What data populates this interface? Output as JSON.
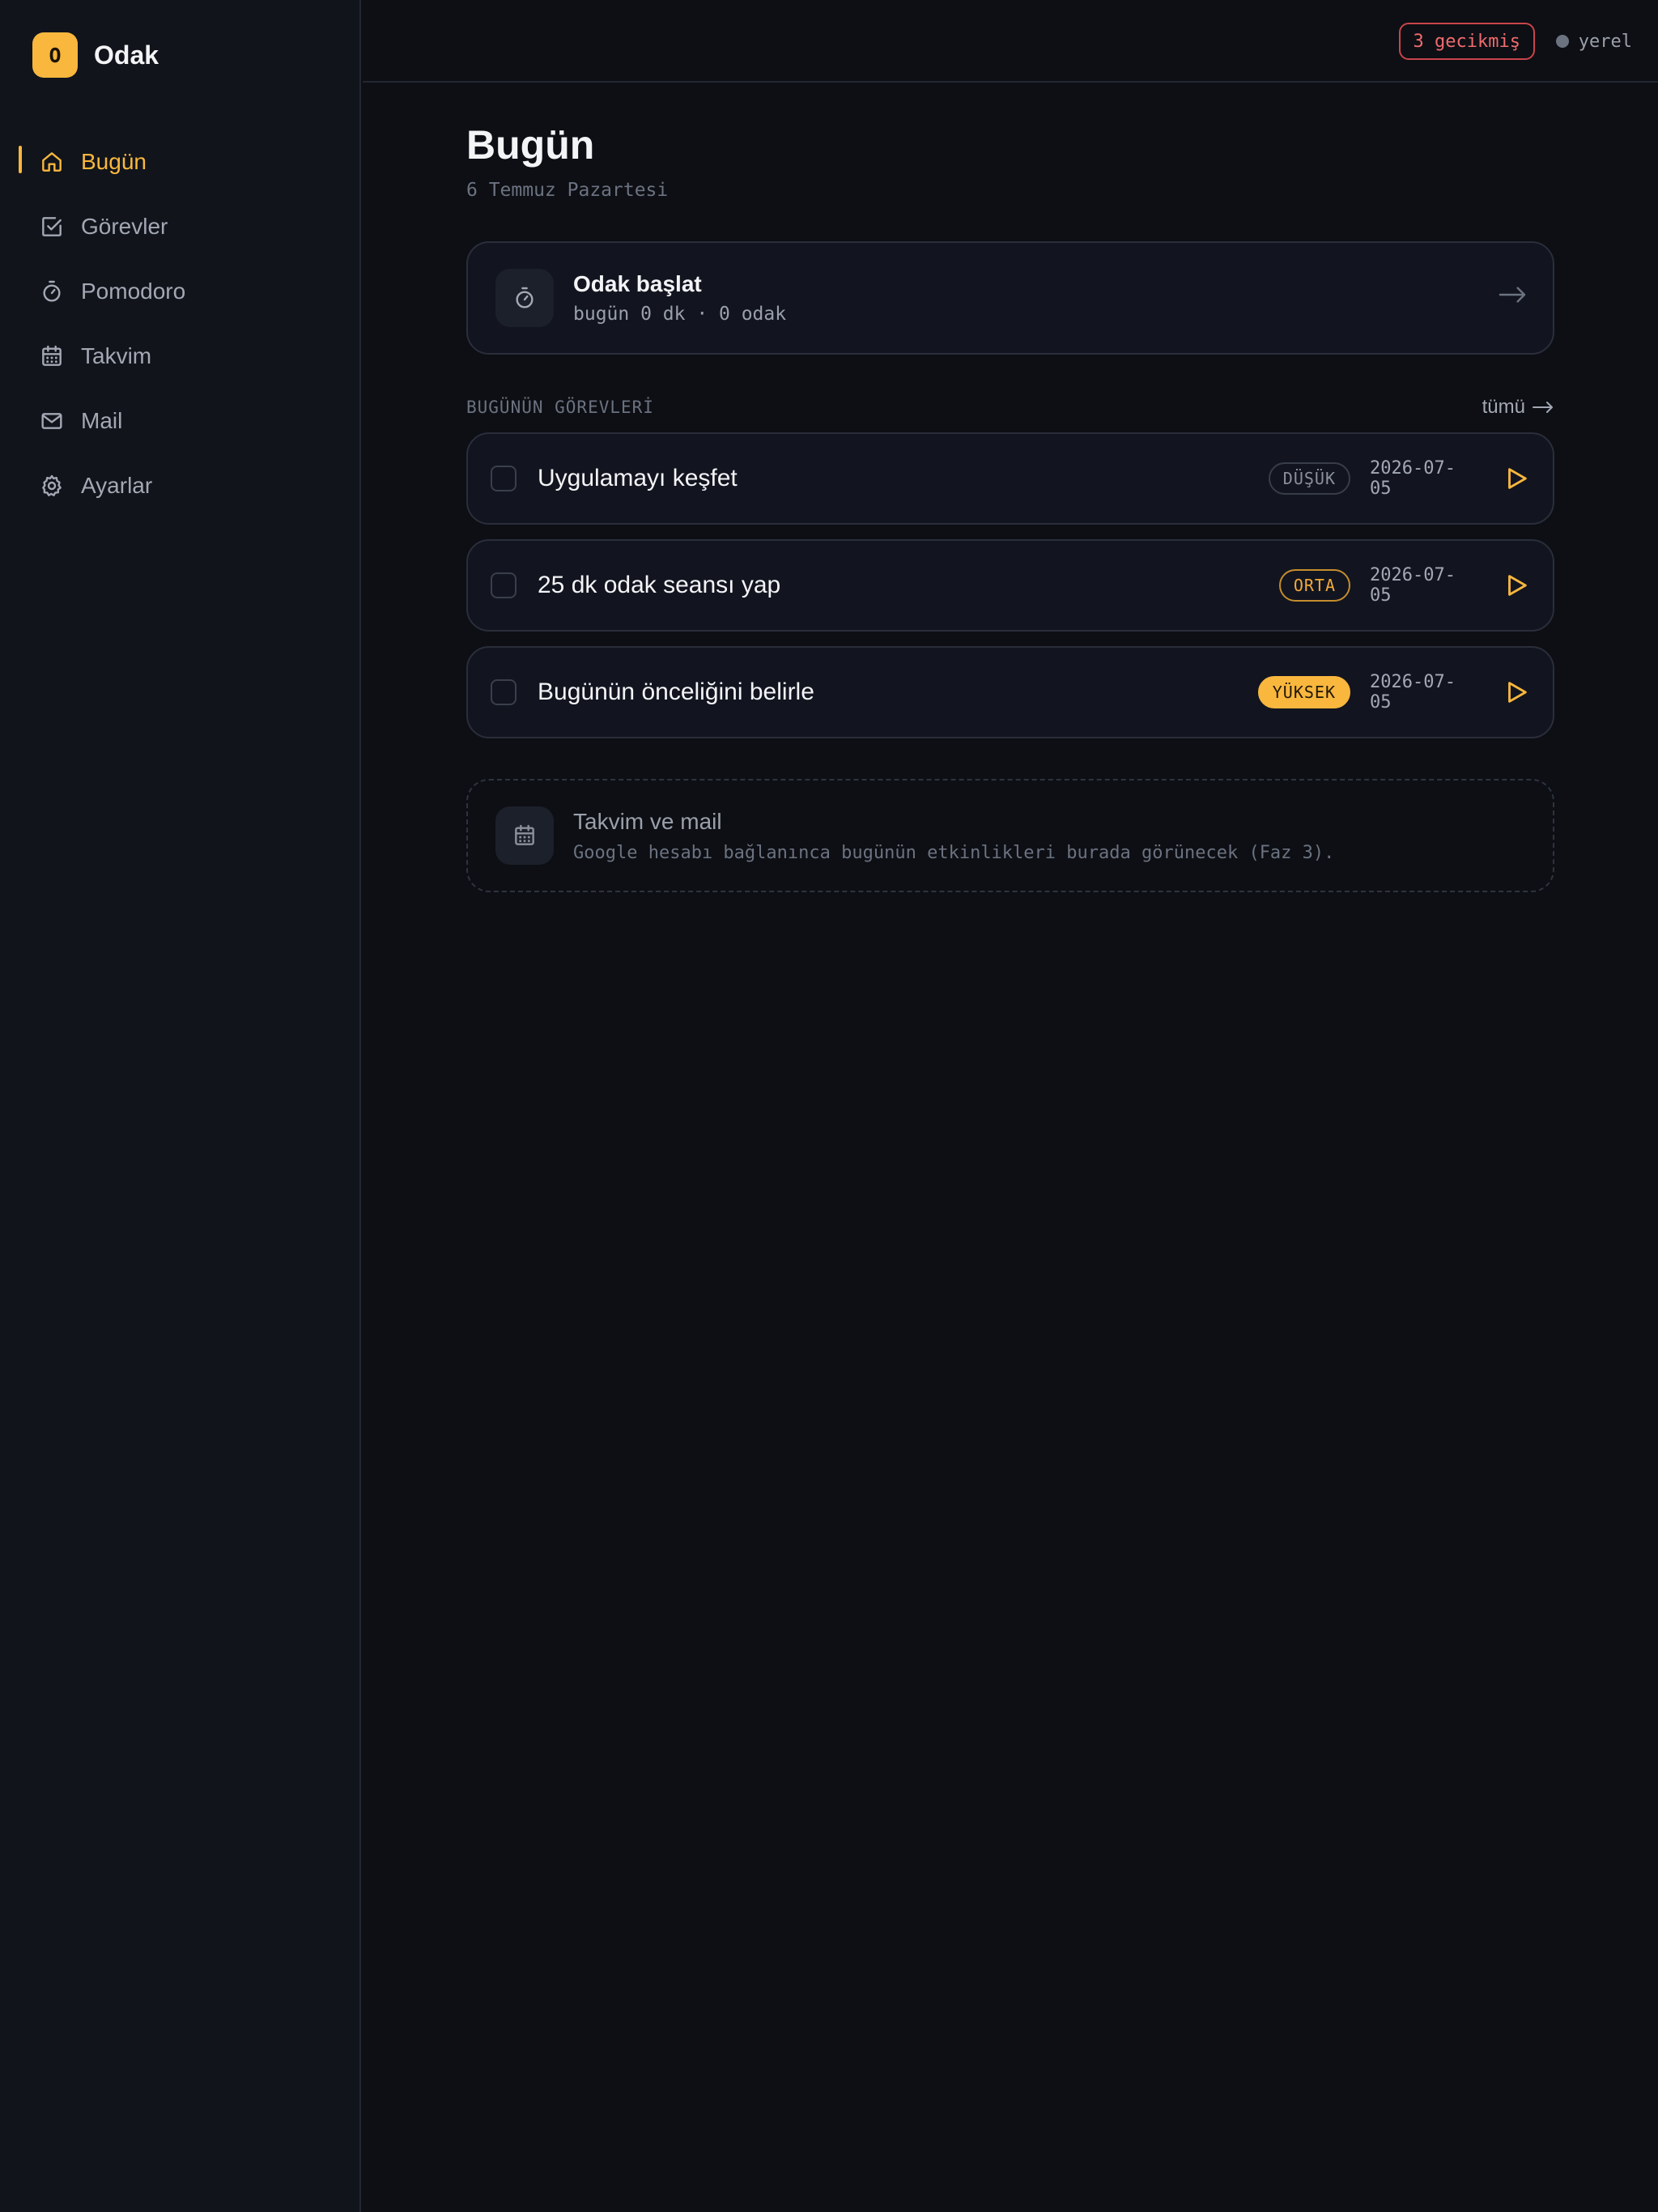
{
  "brand": {
    "logo_letter": "O",
    "name": "Odak"
  },
  "sidebar": {
    "items": [
      {
        "label": "Bugün",
        "icon": "home-icon",
        "active": true
      },
      {
        "label": "Görevler",
        "icon": "checkbox-icon",
        "active": false
      },
      {
        "label": "Pomodoro",
        "icon": "timer-icon",
        "active": false
      },
      {
        "label": "Takvim",
        "icon": "calendar-icon",
        "active": false
      },
      {
        "label": "Mail",
        "icon": "mail-icon",
        "active": false
      },
      {
        "label": "Ayarlar",
        "icon": "gear-icon",
        "active": false
      }
    ]
  },
  "topbar": {
    "overdue": "3 gecikmiş",
    "status": "yerel"
  },
  "page": {
    "title": "Bugün",
    "date": "6 Temmuz Pazartesi"
  },
  "focus": {
    "title": "Odak başlat",
    "subtitle": "bugün 0 dk · 0 odak"
  },
  "tasks_section": {
    "title": "BUGÜNÜN GÖREVLERİ",
    "see_all": "tümü"
  },
  "tasks": [
    {
      "title": "Uygulamayı keşfet",
      "priority": "DÜŞÜK",
      "level": "low",
      "date": "2026-07-05"
    },
    {
      "title": "25 dk odak seansı yap",
      "priority": "ORTA",
      "level": "mid",
      "date": "2026-07-05"
    },
    {
      "title": "Bugünün önceliğini belirle",
      "priority": "YÜKSEK",
      "level": "high",
      "date": "2026-07-05"
    }
  ],
  "calendar": {
    "title": "Takvim ve mail",
    "subtitle": "Google hesabı bağlanınca bugünün etkinlikleri burada görünecek (Faz 3)."
  },
  "colors": {
    "accent": "#f9b73e",
    "danger": "#ef6b6f",
    "background": "#0d0f14",
    "sidebar": "#11141b"
  }
}
